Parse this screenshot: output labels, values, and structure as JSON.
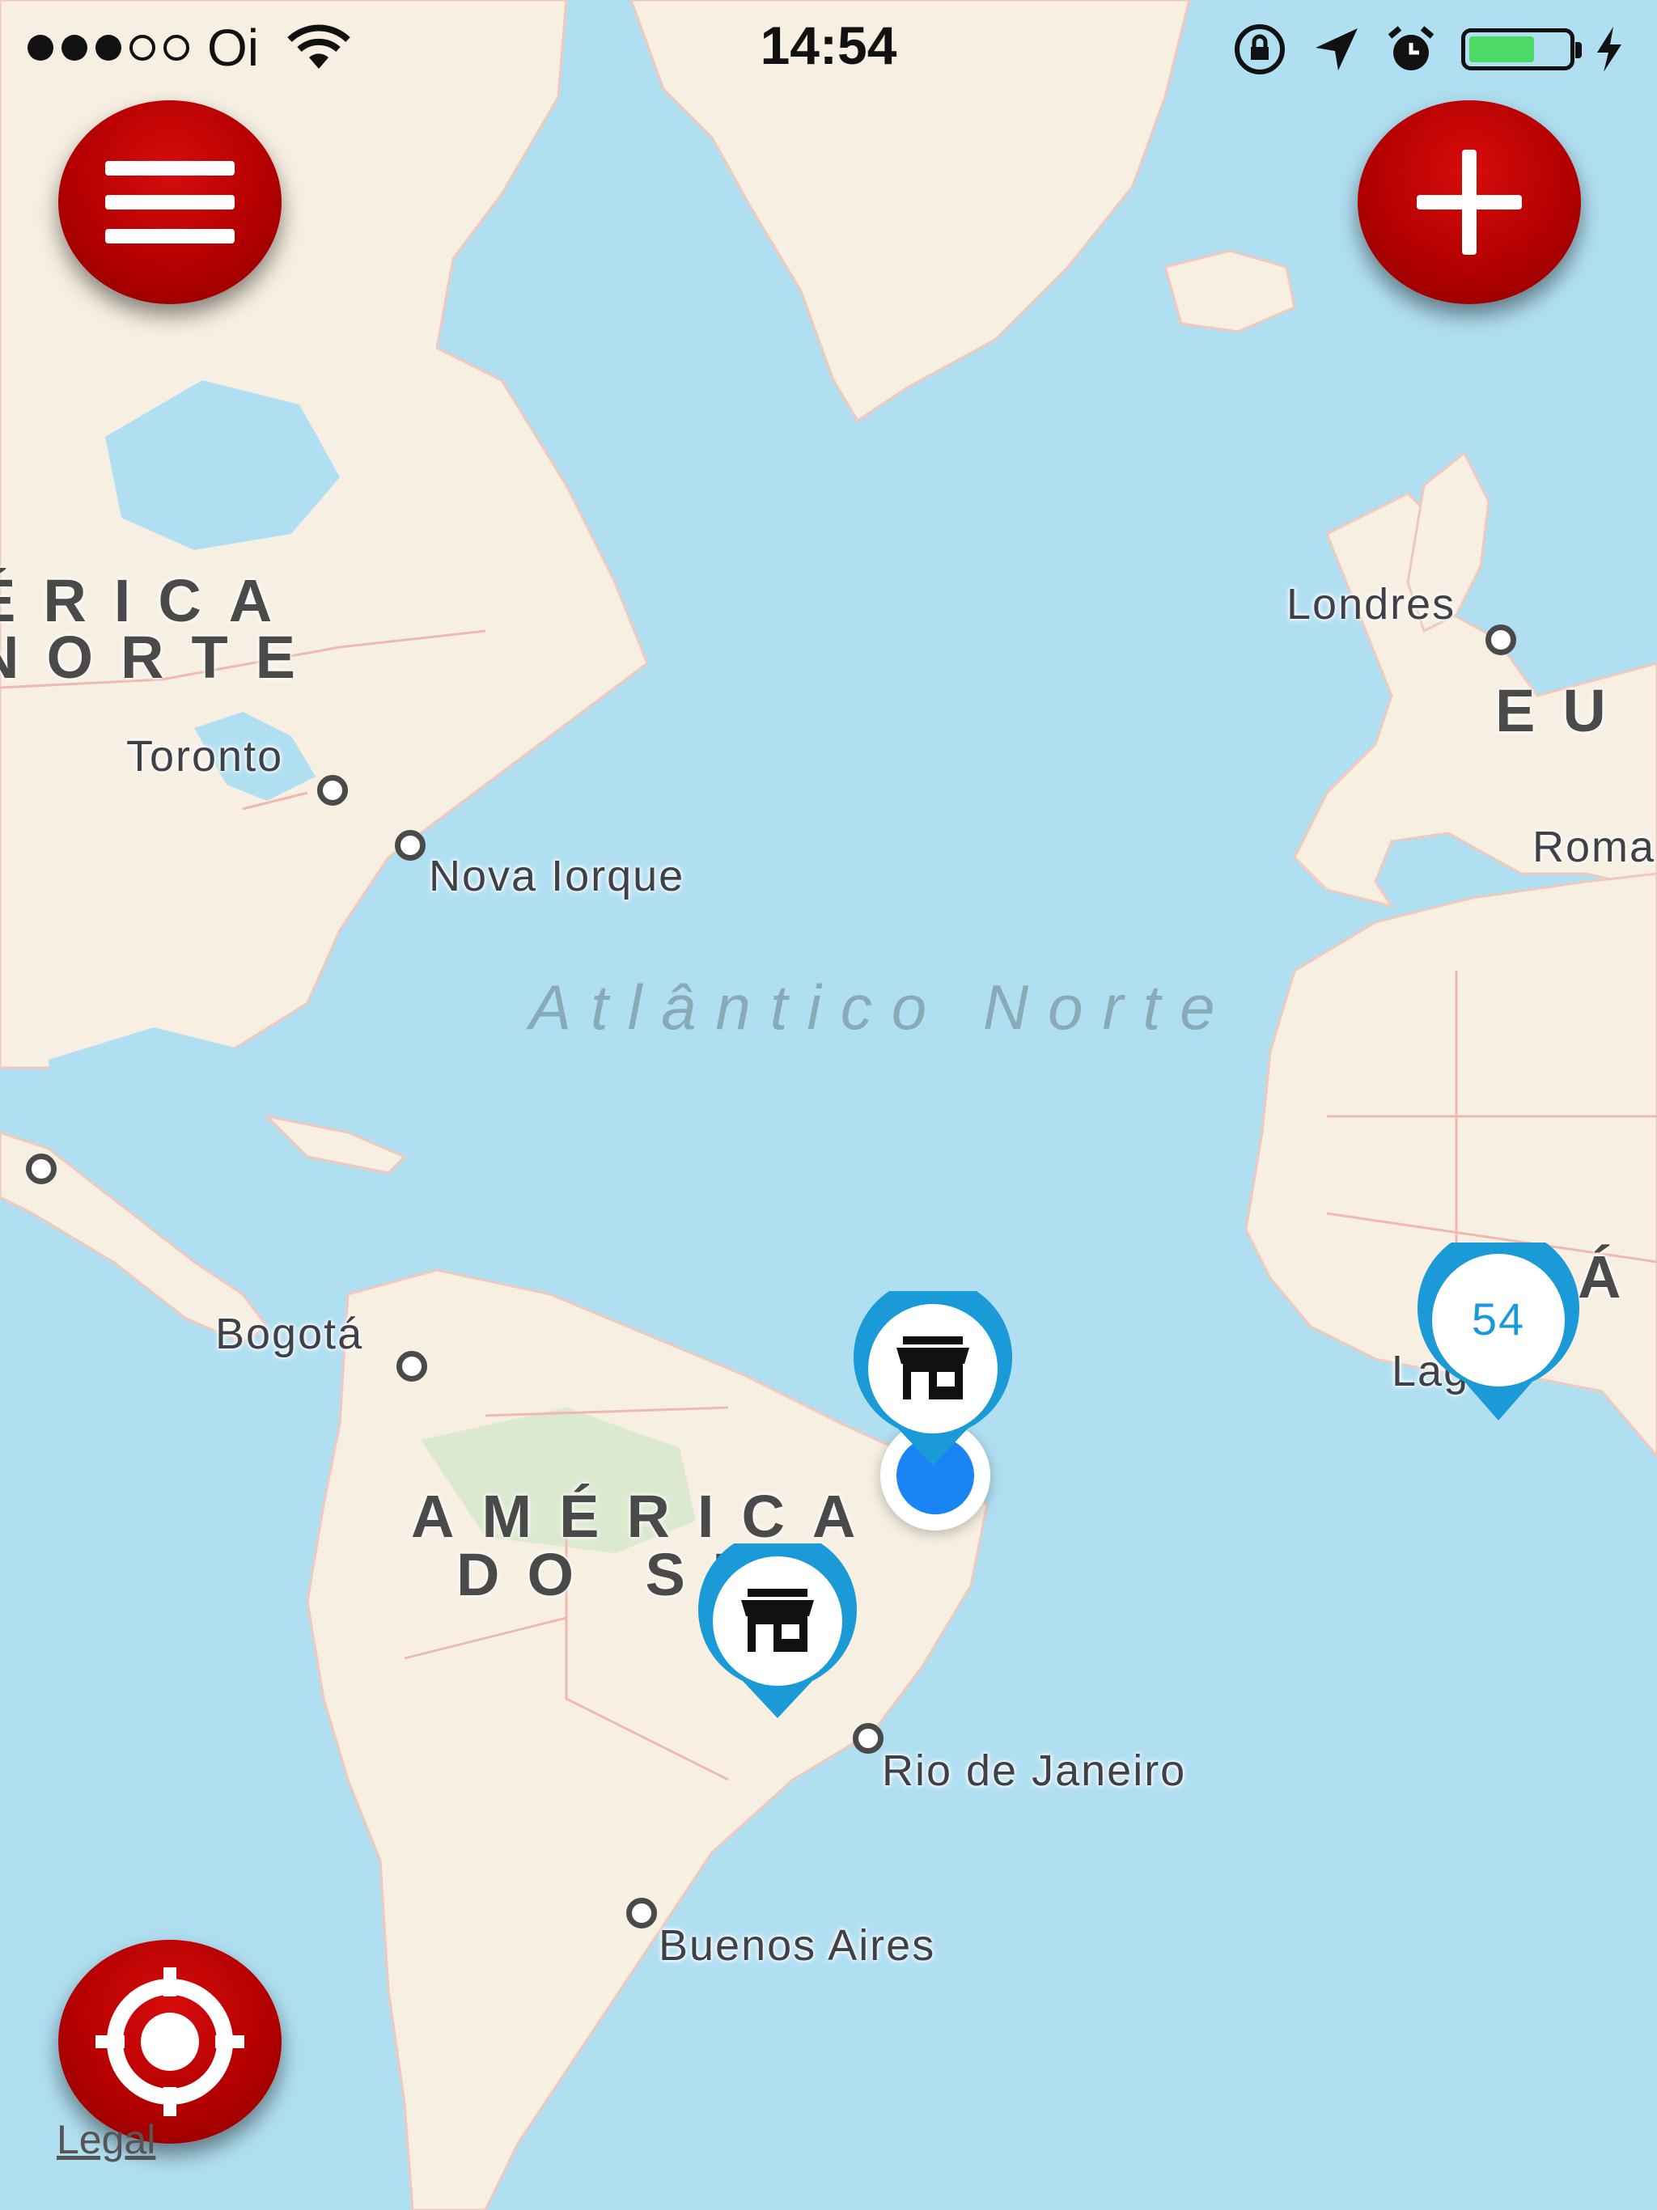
{
  "status_bar": {
    "carrier": "Oi",
    "time": "14:54",
    "battery_color": "#4cd964"
  },
  "buttons": {
    "menu_icon": "hamburger-icon",
    "add_icon": "plus-icon",
    "locate_icon": "crosshair-icon",
    "accent_color": "#c00000"
  },
  "map": {
    "region_labels": {
      "north_america_1": "ÉRICA",
      "north_america_2": "NORTE",
      "south_america_1": "AMÉRICA",
      "south_america_2": "DO SUL",
      "europe": "EU",
      "africa": "Á"
    },
    "ocean_label": "Atlântico Norte",
    "cities": {
      "toronto": "Toronto",
      "new_york": "Nova Iorque",
      "london": "Londres",
      "rome": "Roma",
      "bogota": "Bogotá",
      "rio": "Rio de Janeiro",
      "buenos_aires": "Buenos Aires",
      "lagos": "Lagos"
    },
    "cluster_count": "54",
    "store_pin_icon": "store-icon",
    "pin_color": "#1a9ad6",
    "legal": "Legal"
  }
}
